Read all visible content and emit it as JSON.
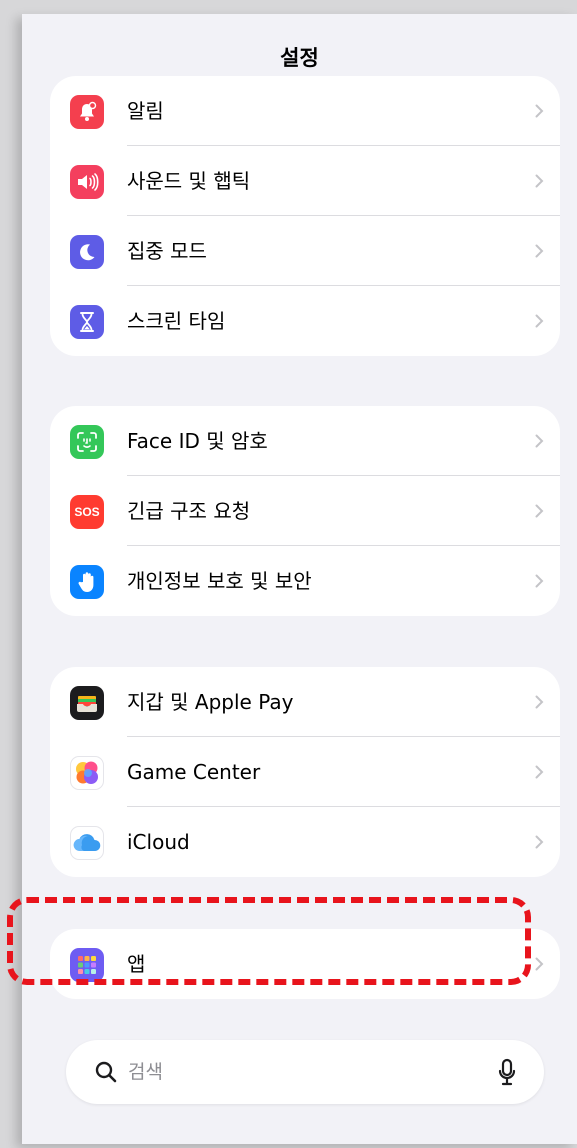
{
  "header": {
    "title": "설정"
  },
  "groups": [
    {
      "items": [
        {
          "label": "알림",
          "icon": "bell-icon",
          "color": "#f43f4e"
        },
        {
          "label": "사운드 및 햅틱",
          "icon": "speaker-icon",
          "color": "#f43f5e"
        },
        {
          "label": "집중 모드",
          "icon": "moon-icon",
          "color": "#5e5ce6"
        },
        {
          "label": "스크린 타임",
          "icon": "hourglass-icon",
          "color": "#5e5ce6"
        }
      ]
    },
    {
      "items": [
        {
          "label": "Face ID 및 암호",
          "icon": "face-id-icon",
          "color": "#34c759"
        },
        {
          "label": "긴급 구조 요청",
          "icon": "sos-icon",
          "icon_text": "SOS",
          "color": "#ff3b30"
        },
        {
          "label": "개인정보 보호 및 보안",
          "icon": "hand-icon",
          "color": "#0a84ff"
        }
      ]
    },
    {
      "items": [
        {
          "label": "지갑 및 Apple Pay",
          "icon": "wallet-icon",
          "color": "#1c1c1e"
        },
        {
          "label": "Game Center",
          "icon": "game-center-icon",
          "color": "#ffffff"
        },
        {
          "label": "iCloud",
          "icon": "icloud-icon",
          "color": "#ffffff"
        }
      ]
    },
    {
      "items": [
        {
          "label": "앱",
          "icon": "apps-grid-icon",
          "color": "#6e5cf2"
        }
      ]
    }
  ],
  "highlight": {
    "target": "앱",
    "color": "#e8141c"
  },
  "search": {
    "placeholder": "검색",
    "icon": "search-icon",
    "mic_icon": "microphone-icon"
  }
}
